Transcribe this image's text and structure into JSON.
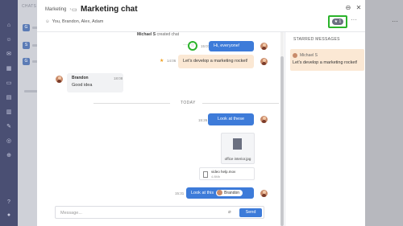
{
  "background": {
    "sidebar_header": "CHATS",
    "more_icon": "more-dots"
  },
  "modal": {
    "breadcrumb_parent": "Marketing",
    "breadcrumb_sep": "›",
    "title": "Marketing chat",
    "members": "You, Brandon, Alex, Adam",
    "star_count": "1",
    "more_glyph": "···"
  },
  "messages": {
    "system": {
      "actor": "Michael S",
      "text": "created chat"
    },
    "m1": {
      "text": "Hi, everyone!",
      "time": "15:01"
    },
    "m2": {
      "text": "Let's develop a marketing rocket!",
      "time": "14:06"
    },
    "m3": {
      "sender": "Brandon",
      "text": "Good idea",
      "time": "18:08"
    },
    "divider": "TODAY",
    "m4": {
      "text": "Look at these",
      "time": "15:26"
    },
    "file1": {
      "name": "office interior.jpg"
    },
    "file2": {
      "name": "video help.mov",
      "size": "4.8Mb"
    },
    "m5": {
      "text": "Look at this",
      "mention": "Brandon",
      "time": "15:31"
    }
  },
  "composer": {
    "placeholder": "Message...",
    "send_label": "Send"
  },
  "starred": {
    "header": "STARRED MESSAGES",
    "items": [
      {
        "sender": "Michael S",
        "text": "Let's develop a marketing rocket!"
      }
    ]
  },
  "colors": {
    "accent": "#3d7bd9",
    "highlight": "#2bb32b",
    "peach": "#fbe8d4"
  }
}
